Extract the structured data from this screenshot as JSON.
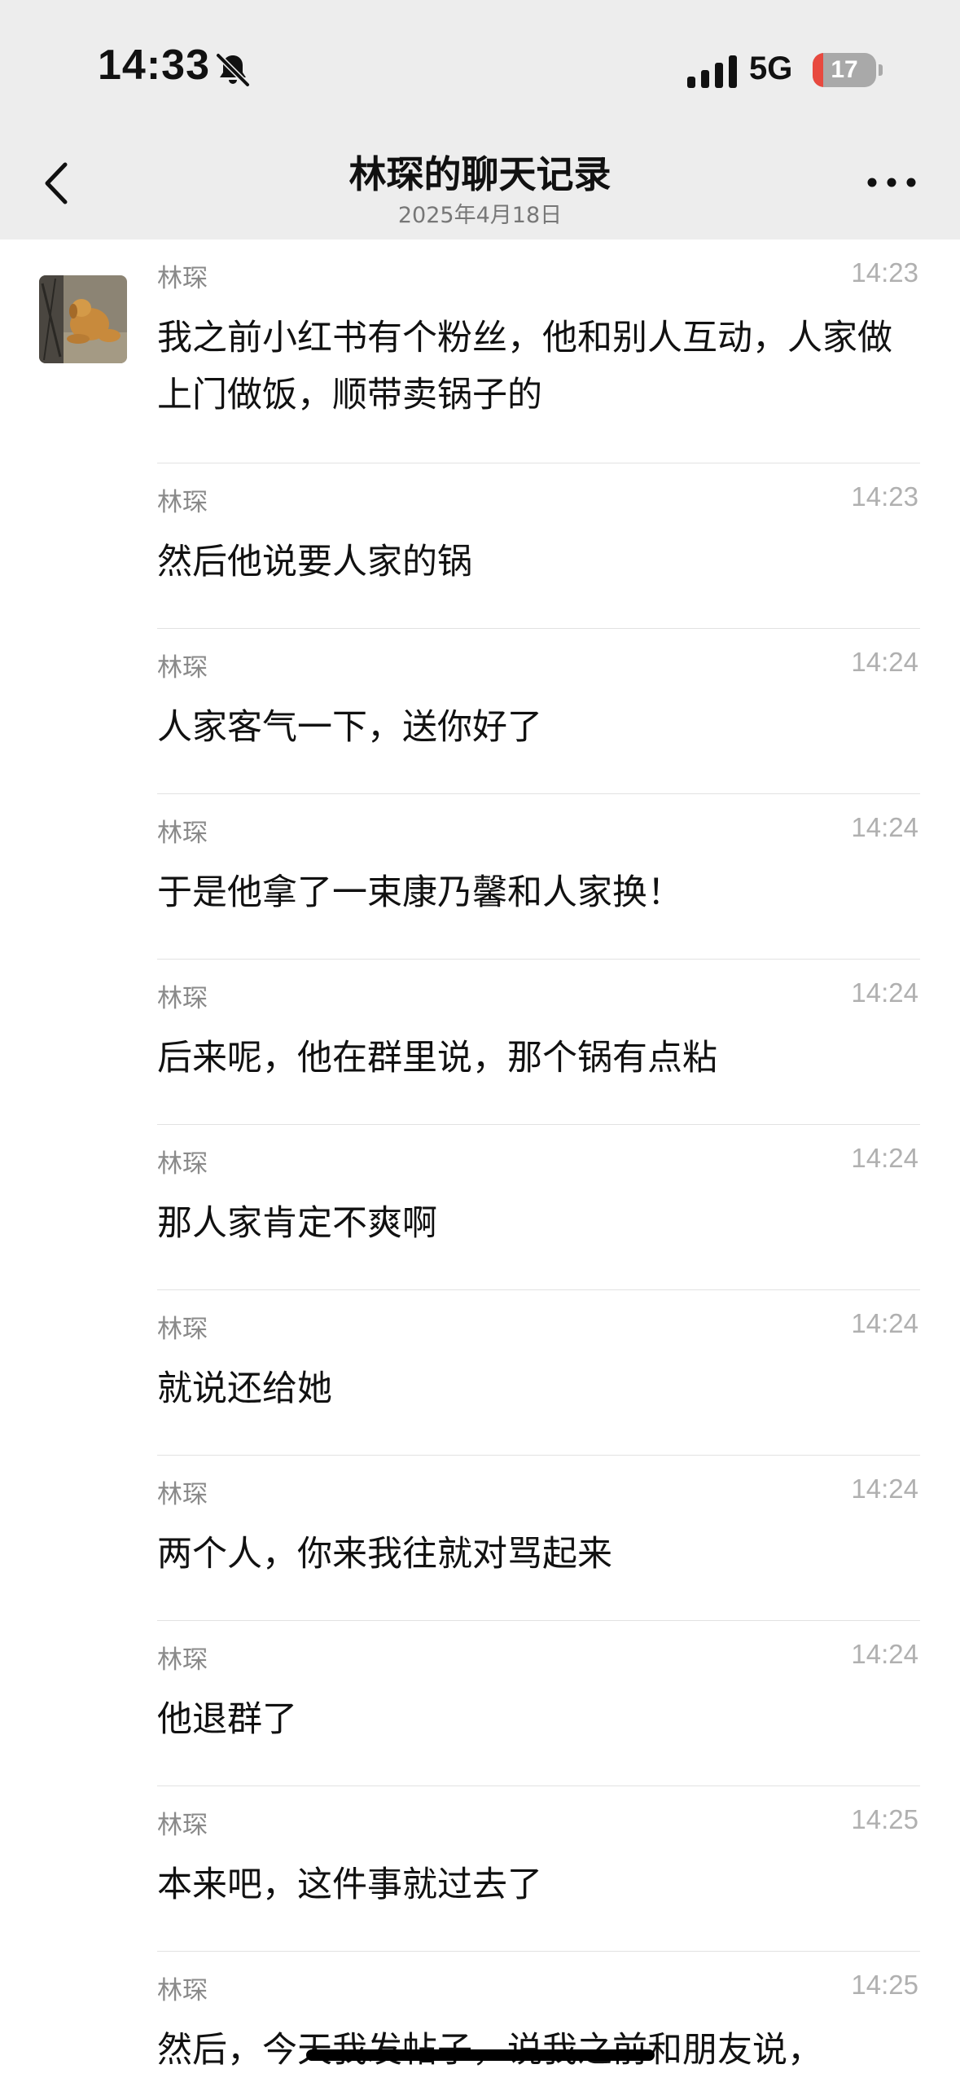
{
  "status_bar": {
    "time": "14:33",
    "network": "5G",
    "battery_level": "17",
    "battery_fraction": 0.17
  },
  "nav": {
    "title": "林琛的聊天记录",
    "subtitle": "2025年4月18日"
  },
  "messages": [
    {
      "sender": "林琛",
      "time": "14:23",
      "text": "我之前小红书有个粉丝，他和别人互动，人家做上门做饭，顺带卖锅子的"
    },
    {
      "sender": "林琛",
      "time": "14:23",
      "text": "然后他说要人家的锅"
    },
    {
      "sender": "林琛",
      "time": "14:24",
      "text": "人家客气一下，送你好了"
    },
    {
      "sender": "林琛",
      "time": "14:24",
      "text": "于是他拿了一束康乃馨和人家换！"
    },
    {
      "sender": "林琛",
      "time": "14:24",
      "text": "后来呢，他在群里说，那个锅有点粘"
    },
    {
      "sender": "林琛",
      "time": "14:24",
      "text": "那人家肯定不爽啊"
    },
    {
      "sender": "林琛",
      "time": "14:24",
      "text": "就说还给她"
    },
    {
      "sender": "林琛",
      "time": "14:24",
      "text": "两个人，你来我往就对骂起来"
    },
    {
      "sender": "林琛",
      "time": "14:24",
      "text": "他退群了"
    },
    {
      "sender": "林琛",
      "time": "14:25",
      "text": "本来吧，这件事就过去了"
    },
    {
      "sender": "林琛",
      "time": "14:25",
      "text": "然后，今天我发帖子，说我之前和朋友说，"
    }
  ],
  "icons": {
    "mute": "bell-slash-icon",
    "signal": "cellular-signal-icon",
    "back": "chevron-left-icon",
    "more": "more-dots-icon",
    "avatar": "dog-photo-avatar"
  },
  "colors": {
    "bar_background": "#ededed",
    "battery_low": "#e8493f",
    "timestamp": "#b0b0b0",
    "sender": "#8a8a8a"
  }
}
